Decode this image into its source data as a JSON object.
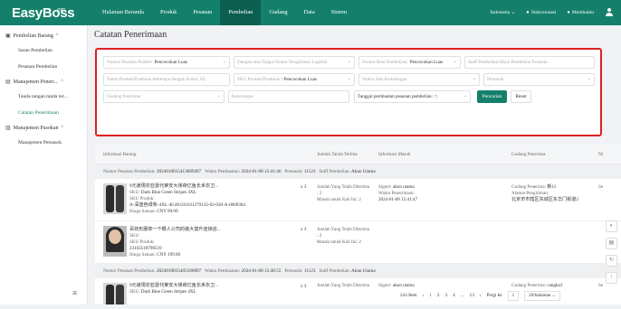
{
  "app": {
    "logo": "EasyBoss",
    "logo_suffix": ".com"
  },
  "nav": [
    {
      "label": "Halaman Beranda"
    },
    {
      "label": "Produk"
    },
    {
      "label": "Pesanan"
    },
    {
      "label": "Pembelian"
    },
    {
      "label": "Gudang"
    },
    {
      "label": "Data"
    },
    {
      "label": "Sistem"
    }
  ],
  "top_right": {
    "language": "Indonesia",
    "sync": "Sinkronisasi",
    "help": "Membantu"
  },
  "sidebar": {
    "groups": [
      {
        "label": "Pembelian Barang",
        "items": [
          {
            "label": "Saran Pembelian"
          },
          {
            "label": "Pesanan Pembelian"
          }
        ]
      },
      {
        "label": "Manajemen Peneri...",
        "items": [
          {
            "label": "Tanda tangan tanda ter..."
          },
          {
            "label": "Catatan Penerimaan"
          }
        ]
      },
      {
        "label": "Manajemen Pasokan",
        "items": [
          {
            "label": "Manajemen Pemasok"
          }
        ]
      }
    ]
  },
  "page_title": "Catatan Penerimaan",
  "filters": {
    "f1_placeholder": "Nomor Pesanan Pembel",
    "f1_select": "Pencocokan Luas",
    "f2_placeholder": "Dengan atau Tanpa Nomor Pengiriman Logistik",
    "f3_placeholder": "Nomor Resi Pembelian(",
    "f3_select": "Pencocokan Luas",
    "f4_placeholder": "Staff Pembelian/Akun Pembelian Pesanan",
    "f5_placeholder": "Nama Produk(Pisahkan Beberapa dengan Koma, Id)",
    "f6_placeholder": "SKU Produk(Pisahkan I",
    "f6_select": "Pencocokan Luas",
    "f7_placeholder": "Waktu Sisa Kedatangan",
    "f8_placeholder": "Pemasok",
    "f9_placeholder": "Gudang Penerima",
    "f10_placeholder": "Keterangan",
    "f11_label": "Tanggal pembuatan pesanan pembelian:",
    "search_button": "Pencarian",
    "reset_button": "Reset"
  },
  "table": {
    "headers": [
      "Informasi Barang",
      "Jumlah Tanda Terima",
      "Informasi Masuk",
      "Gudang Penerima",
      "Ni"
    ],
    "groups": [
      {
        "order_label": "Nomor Pesanan Pembelian:",
        "order_no": "2024010815413609497",
        "time_label": "Waktu Pembuatan:",
        "time": "2024-01-08 15:41:40",
        "supplier_label": "Pemasok:",
        "supplier": "11123",
        "staff_label": "Staff Pembelian:",
        "staff": "Akun Utama",
        "rows": [
          {
            "name": "9元速現衣亚瑟代莱安大褂荷亿鱼长禾衣卫...",
            "sku_label": "SKU:",
            "sku": "Dark Blue Green Stripes 4XL",
            "sku_produk_label": "SKU Produk:",
            "sku_produk": "A-深蓝色绿条-4XL-46.00.631631279132-03-030-A-0000304",
            "price_label": "Harga Satuan:",
            "price": "CNY 99.00",
            "qty": "x 3",
            "received_label": "Jumlah Yang Telah Diterima",
            "received": ": 2",
            "in_label": "Masuk untuk Kali Ini:",
            "in": "2",
            "signer_label": "Signer:",
            "signer": "akun utama",
            "receipt_time_label": "Waktu Penerimaan:",
            "receipt_time": "2024-01-08 15:41:47",
            "wh_label": "Gudang Penerima:",
            "wh": "新11",
            "addr_label": "Alamat Pengiriman:",
            "addr": "北京市市辖区东城区东华门街道2",
            "extra": "Se"
          },
          {
            "name": "百效形服饰一个概人公司的装大富升连锁店...",
            "sku_label": "SKU:",
            "sku": "",
            "sku_produk_label": "SKU Produk:",
            "sku_produk": "23102518796519",
            "price_label": "Harga Satuan:",
            "price": "CNY 199.00",
            "qty": "x 3",
            "received_label": "Jumlah Yang Telah Diterima",
            "received": ": 2",
            "in_label": "Masuk untuk Kali Ini:",
            "in": "2"
          }
        ]
      },
      {
        "order_label": "Nomor Pesanan Pembelian:",
        "order_no": "2024010815405106897",
        "time_label": "Waktu Pembuatan:",
        "time": "2024-01-08 15:40:55",
        "supplier_label": "Pemasok:",
        "supplier": "11123",
        "staff_label": "Staff Pembelian:",
        "staff": "Akun Utama",
        "rows": [
          {
            "name": "9元速現衣亚瑟代莱安大褂荷亿鱼长禾衣卫...",
            "sku_label": "SKU:",
            "sku": "Dark Blue Green Stripes 4XL",
            "qty": "x 3",
            "received_label": "Jumlah Yang Telah Diterima",
            "signer_label": "Signer:",
            "signer": "akun utama",
            "wh_label": "Gudang Penerima:",
            "wh": "cangku3",
            "extra": "Se"
          }
        ]
      }
    ]
  },
  "pager": {
    "total": "243 Item",
    "pages": [
      "1",
      "2",
      "3",
      "4",
      "...",
      "13"
    ],
    "goto_label": "Pergi ke",
    "goto_value": "1",
    "page_size": "20/halaman"
  }
}
